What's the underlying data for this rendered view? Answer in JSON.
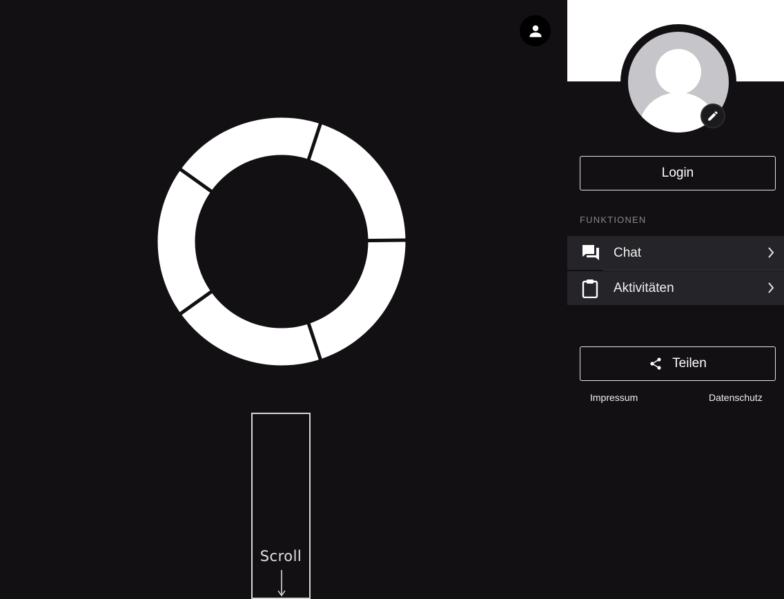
{
  "main": {
    "scroll_label": "Scroll",
    "icons": {
      "account": "account-icon",
      "brand": "ring-logo",
      "scroll_arrow": "arrow-down-icon"
    }
  },
  "panel": {
    "login_label": "Login",
    "section_title": "FUNKTIONEN",
    "menu": [
      {
        "label": "Chat",
        "icon": "chat-icon"
      },
      {
        "label": "Aktivitäten",
        "icon": "clipboard-icon"
      }
    ],
    "share_label": "Teilen",
    "footer": {
      "impressum": "Impressum",
      "datenschutz": "Datenschutz"
    }
  },
  "colors": {
    "background": "#121013",
    "menu_item": "#252428",
    "avatar": "#c6c5ca",
    "muted_text": "#88868b",
    "white": "#ffffff"
  }
}
